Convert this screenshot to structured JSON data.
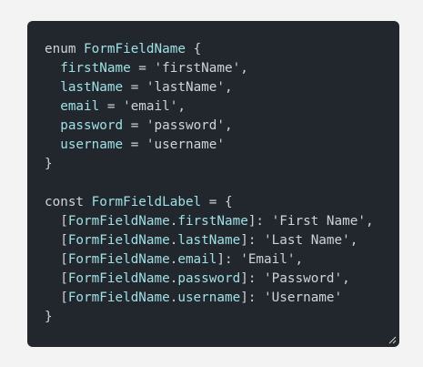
{
  "code": {
    "enum_keyword": "enum",
    "enum_name": "FormFieldName",
    "enum_open": "{",
    "enum_members": [
      {
        "name": "firstName",
        "value": "'firstName'",
        "sep": ","
      },
      {
        "name": "lastName",
        "value": "'lastName'",
        "sep": ","
      },
      {
        "name": "email",
        "value": "'email'",
        "sep": ","
      },
      {
        "name": "password",
        "value": "'password'",
        "sep": ","
      },
      {
        "name": "username",
        "value": "'username'",
        "sep": ""
      }
    ],
    "enum_close": "}",
    "const_keyword": "const",
    "const_name": "FormFieldLabel",
    "const_assign": "= {",
    "label_entries": [
      {
        "ref": "FormFieldName",
        "key": "firstName",
        "label": "'First Name'",
        "sep": ","
      },
      {
        "ref": "FormFieldName",
        "key": "lastName",
        "label": "'Last Name'",
        "sep": ","
      },
      {
        "ref": "FormFieldName",
        "key": "email",
        "label": "'Email'",
        "sep": ","
      },
      {
        "ref": "FormFieldName",
        "key": "password",
        "label": "'Password'",
        "sep": ","
      },
      {
        "ref": "FormFieldName",
        "key": "username",
        "label": "'Username'",
        "sep": ""
      }
    ],
    "const_close": "}"
  }
}
